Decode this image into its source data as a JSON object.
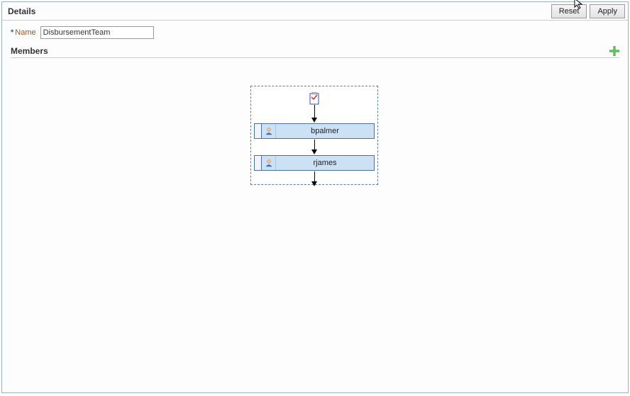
{
  "header": {
    "title": "Details",
    "reset_label": "Reset",
    "apply_label": "Apply"
  },
  "form": {
    "name_label": "Name",
    "name_value": "DisbursementTeam"
  },
  "members_section": {
    "title": "Members",
    "nodes": [
      {
        "label": "bpalmer"
      },
      {
        "label": "rjames"
      }
    ]
  }
}
